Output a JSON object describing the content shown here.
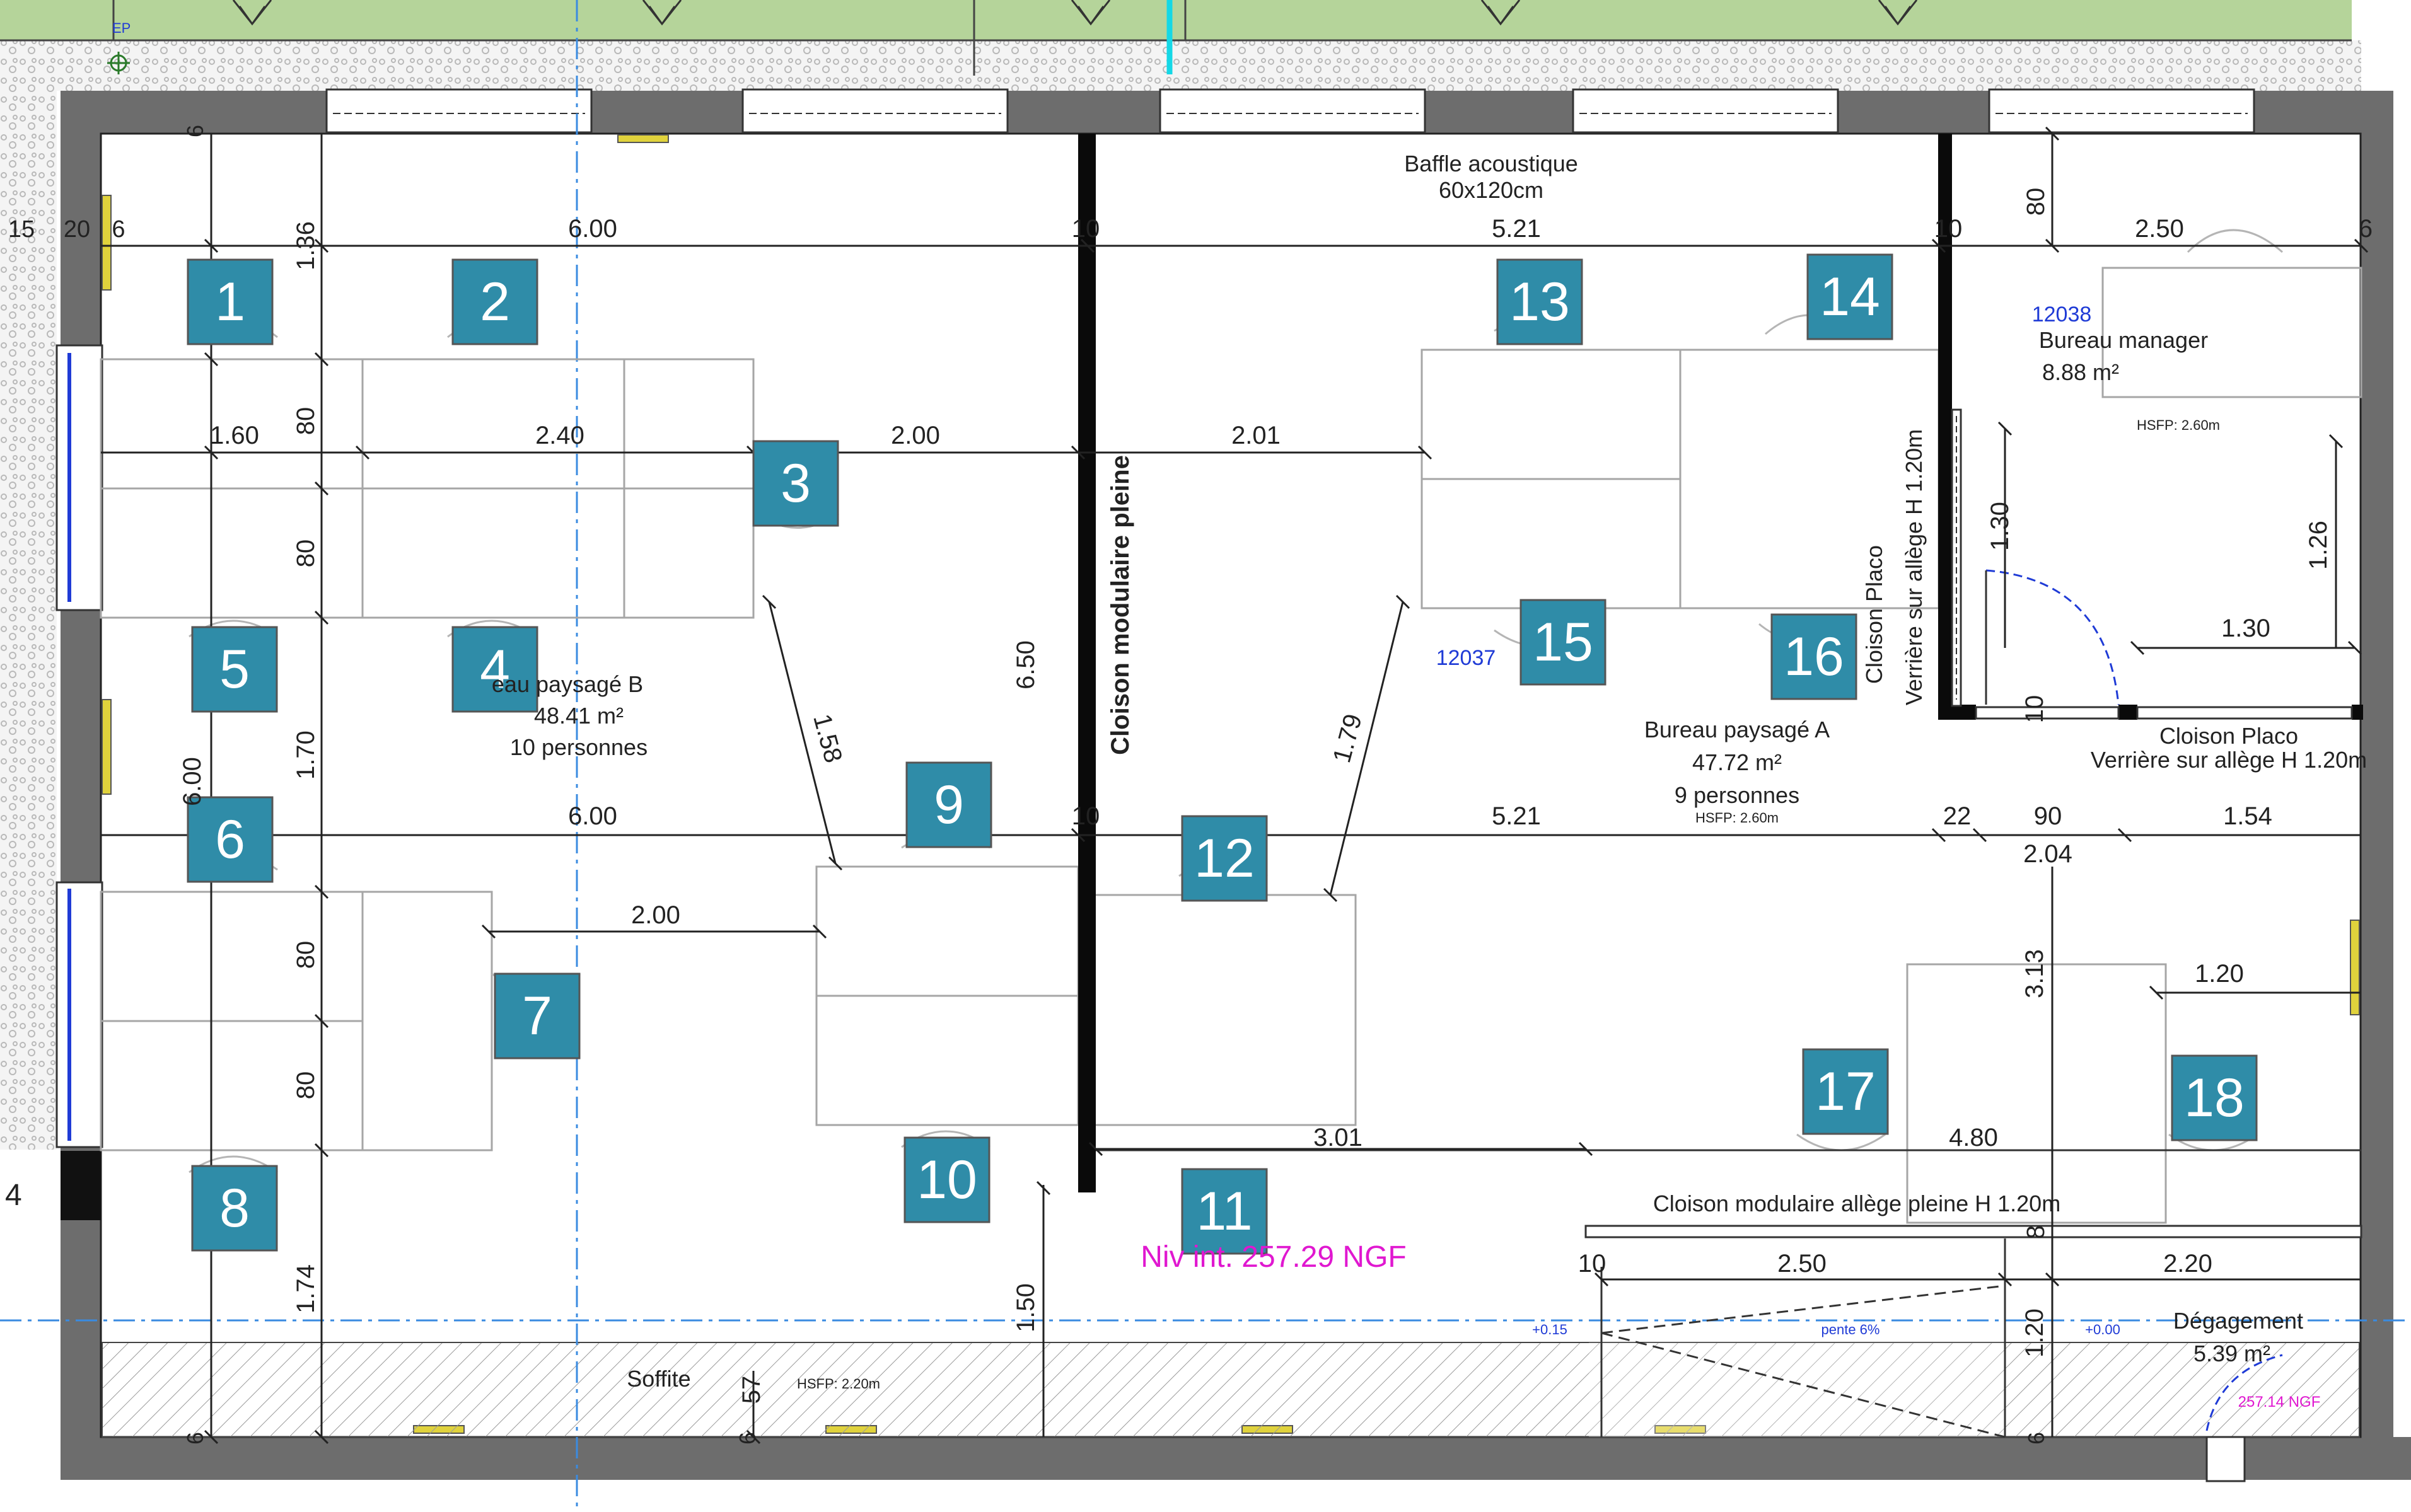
{
  "rooms": {
    "paysage_b": {
      "name_visible": "eau paysagé B",
      "area": "48.41 m²",
      "persons": "10 personnes"
    },
    "paysage_a": {
      "name": "Bureau paysagé A",
      "area": "47.72 m²",
      "persons": "9 personnes",
      "hsfp": "HSFP: 2.60m",
      "code": "12037"
    },
    "manager": {
      "code": "12038",
      "name": "Bureau manager",
      "area": "8.88 m²",
      "hsfp": "HSFP: 2.60m"
    },
    "degagement": {
      "name": "Dégagement",
      "area": "5.39 m²",
      "level": "257.14 NGF",
      "level_left": "+0.00"
    }
  },
  "labels": {
    "baffle_title": "Baffle acoustique",
    "baffle_size": "60x120cm",
    "cloison_pleine": "Cloison modulaire pleine",
    "cloison_placo_1": "Cloison Placo",
    "verriere_1": "Verrière sur allège  H 1.20m",
    "cloison_placo_2": "Cloison Placo",
    "verriere_2": "Verrière sur allège  H 1.20m",
    "cloison_allege": "Cloison modulaire allège pleine H 1.20m",
    "soffite": "Soffite",
    "soffite_hsfp": "HSFP: 2.20m",
    "level": "Niv int. 257.29 NGF",
    "pente": "pente 6%",
    "level_plus": "+0.15",
    "ep": "EP",
    "left_edge": "4"
  },
  "desks": [
    "1",
    "2",
    "3",
    "4",
    "5",
    "6",
    "7",
    "8",
    "9",
    "10",
    "11",
    "12",
    "13",
    "14",
    "15",
    "16",
    "17",
    "18"
  ],
  "dims": {
    "d6": "6",
    "d15": "15",
    "d20": "20",
    "d6b": "6",
    "d136": "1.36",
    "d600a": "6.00",
    "d10a": "10",
    "d521a": "5.21",
    "d10b": "10",
    "d250a": "2.50",
    "d6c": "6",
    "d80a": "80",
    "d160": "1.60",
    "d240": "2.40",
    "d200a": "2.00",
    "d201": "2.01",
    "d80b": "80",
    "d80c": "80",
    "d170": "1.70",
    "d600v": "6.00",
    "d650": "6.50",
    "d158": "1.58",
    "d179": "1.79",
    "d600b": "6.00",
    "d10c": "10",
    "d521b": "5.21",
    "d22": "22",
    "d90": "90",
    "d204": "2.04",
    "d154": "1.54",
    "d130v": "1.30",
    "d126": "1.26",
    "d130h": "1.30",
    "d10d": "10",
    "d200b": "2.00",
    "d80d": "80",
    "d80e": "80",
    "d313": "3.13",
    "d120a": "1.20",
    "d480": "4.80",
    "d301": "3.01",
    "d174": "1.74",
    "d150": "1.50",
    "d57": "57",
    "d6d": "6",
    "d6e": "6",
    "d6f": "6",
    "d10e": "10",
    "d250b": "2.50",
    "d8": "8",
    "d220": "2.20",
    "d120b": "1.20"
  },
  "colors": {
    "desk_fill": "#2f8ca8",
    "wall": "#6d6d6d",
    "blue_text": "#1f3bd6",
    "magenta": "#e018d0",
    "grass": "#b5d49a",
    "axis": "#3a8be0"
  }
}
